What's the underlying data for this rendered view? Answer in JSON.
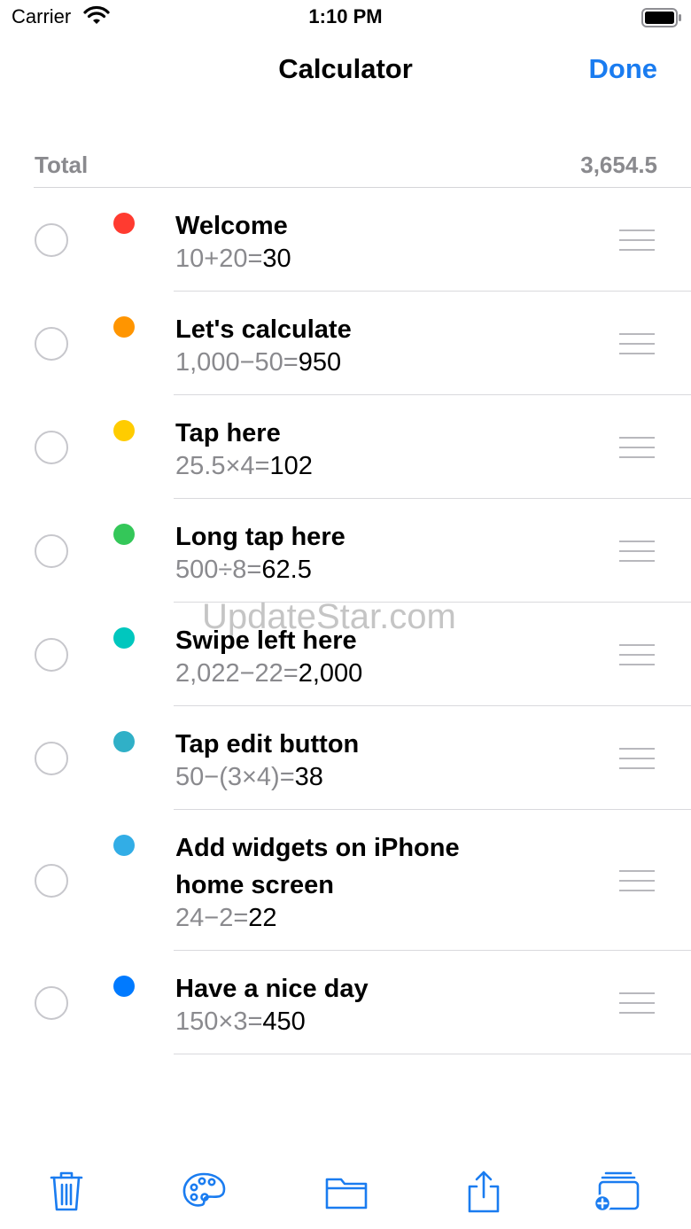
{
  "status_bar": {
    "carrier": "Carrier",
    "time": "1:10 PM"
  },
  "nav": {
    "title": "Calculator",
    "done": "Done"
  },
  "total": {
    "label": "Total",
    "value": "3,654.5"
  },
  "items": [
    {
      "title": "Welcome",
      "lhs": "10+20=",
      "result": "30",
      "color": "#ff3b30"
    },
    {
      "title": "Let's calculate",
      "lhs": "1,000−50=",
      "result": "950",
      "color": "#ff9500"
    },
    {
      "title": "Tap here",
      "lhs": "25.5×4=",
      "result": "102",
      "color": "#ffcc00"
    },
    {
      "title": "Long tap here",
      "lhs": "500÷8=",
      "result": "62.5",
      "color": "#34c759"
    },
    {
      "title": "Swipe left here",
      "lhs": "2,022−22=",
      "result": "2,000",
      "color": "#00c7be"
    },
    {
      "title": "Tap edit button",
      "lhs": "50−(3×4)=",
      "result": "38",
      "color": "#30b0c7"
    },
    {
      "title": "Add widgets on iPhone home screen",
      "lhs": "24−2=",
      "result": "22",
      "color": "#32ade6"
    },
    {
      "title": "Have a nice day",
      "lhs": "150×3=",
      "result": "450",
      "color": "#007aff"
    }
  ],
  "watermark": "UpdateStar.com",
  "colors": {
    "accent": "#1a7cf0",
    "secondary_text": "#8a8a8e"
  },
  "toolbar": {
    "icons": [
      "trash-icon",
      "palette-icon",
      "folder-icon",
      "share-icon",
      "add-sheet-icon"
    ]
  }
}
